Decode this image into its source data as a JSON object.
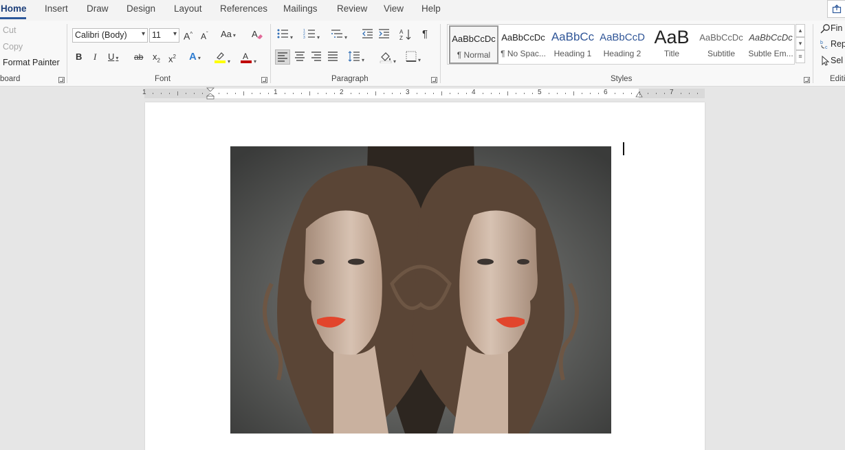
{
  "tabs": [
    "Home",
    "Insert",
    "Draw",
    "Design",
    "Layout",
    "References",
    "Mailings",
    "Review",
    "View",
    "Help"
  ],
  "active_tab": "Home",
  "clipboard": {
    "cut": "Cut",
    "copy": "Copy",
    "format_painter": "Format Painter",
    "label": "board"
  },
  "font": {
    "name": "Calibri (Body)",
    "size": "11",
    "label": "Font",
    "grow": "A",
    "shrink": "A",
    "change_case": "Aa",
    "bold": "B",
    "italic": "I",
    "underline": "U",
    "strike": "ab",
    "subscript": "x",
    "superscript": "x",
    "effects": "A",
    "color": "A",
    "highlight_color": "#ffff00",
    "font_color": "#c00000"
  },
  "paragraph": {
    "label": "Paragraph",
    "pilcrow": "¶"
  },
  "styles": {
    "label": "Styles",
    "items": [
      {
        "preview": "AaBbCcDc",
        "name": "¶ Normal"
      },
      {
        "preview": "AaBbCcDc",
        "name": "¶ No Spac..."
      },
      {
        "preview": "AaBbCc",
        "name": "Heading 1"
      },
      {
        "preview": "AaBbCcD",
        "name": "Heading 2"
      },
      {
        "preview": "AaB",
        "name": "Title"
      },
      {
        "preview": "AaBbCcDc",
        "name": "Subtitle"
      },
      {
        "preview": "AaBbCcDc",
        "name": "Subtle Em..."
      }
    ]
  },
  "editing": {
    "find": "Fin",
    "replace": "Rep",
    "select": "Sel",
    "label": "Editi"
  },
  "ruler": {
    "numbers": [
      "1",
      "1",
      "2",
      "3",
      "4",
      "5",
      "6",
      "7"
    ]
  },
  "accent_color": "#2b579a"
}
